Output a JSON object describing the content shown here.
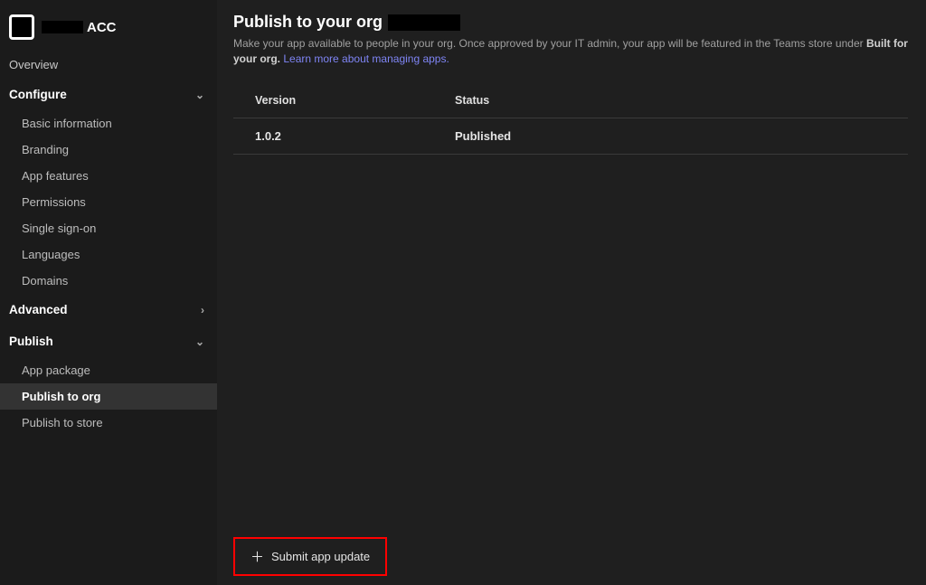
{
  "sidebar": {
    "app_label": "ACC",
    "overview": "Overview",
    "configure": {
      "label": "Configure",
      "items": [
        "Basic information",
        "Branding",
        "App features",
        "Permissions",
        "Single sign-on",
        "Languages",
        "Domains"
      ]
    },
    "advanced": "Advanced",
    "publish": {
      "label": "Publish",
      "items": [
        "App package",
        "Publish to org",
        "Publish to store"
      ]
    }
  },
  "main": {
    "title": "Publish to your org",
    "desc_prefix": "Make your app available to people in your org. Once approved by your IT admin, your app will be featured in the Teams store under ",
    "desc_bold": "Built for your org.",
    "desc_link": "Learn more about managing apps.",
    "table": {
      "headers": {
        "version": "Version",
        "status": "Status"
      },
      "row": {
        "version": "1.0.2",
        "status": "Published"
      }
    },
    "submit_button": "Submit app update"
  }
}
